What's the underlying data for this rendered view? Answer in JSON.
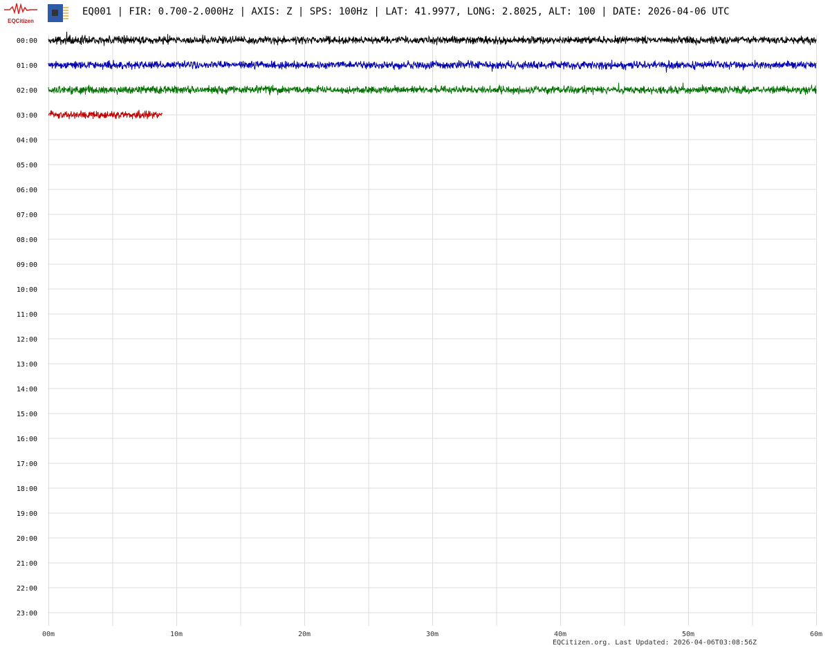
{
  "header": {
    "title": "EQ001 | FIR: 0.700-2.000Hz | AXIS: Z | SPS: 100Hz | LAT: 41.9977, LONG: 2.8025, ALT: 100 | DATE: 2026-04-06 UTC",
    "logo_text": "EQCitizen",
    "logo_icon": "seismogram-logo-icon",
    "device_icon": "sensor-chip-icon"
  },
  "chart_data": {
    "type": "line",
    "title": "EQ001 | FIR: 0.700-2.000Hz | AXIS: Z | SPS: 100Hz | LAT: 41.9977, LONG: 2.8025, ALT: 100 | DATE: 2026-04-06 UTC",
    "xlabel": "",
    "ylabel": "",
    "xlim": [
      0,
      60
    ],
    "x_ticks": [
      "00m",
      "10m",
      "20m",
      "30m",
      "40m",
      "50m",
      "60m"
    ],
    "y_ticks": [
      "00:00",
      "01:00",
      "02:00",
      "03:00",
      "04:00",
      "05:00",
      "06:00",
      "07:00",
      "08:00",
      "09:00",
      "10:00",
      "11:00",
      "12:00",
      "13:00",
      "14:00",
      "15:00",
      "16:00",
      "17:00",
      "18:00",
      "19:00",
      "20:00",
      "21:00",
      "22:00",
      "23:00"
    ],
    "grid": true,
    "series": [
      {
        "name": "00:00",
        "start_min": 0,
        "end_min": 60,
        "color": "#000000"
      },
      {
        "name": "01:00",
        "start_min": 0,
        "end_min": 60,
        "color": "#0000b0"
      },
      {
        "name": "02:00",
        "start_min": 0,
        "end_min": 60,
        "color": "#007000"
      },
      {
        "name": "03:00",
        "start_min": 0,
        "end_min": 8.93,
        "color": "#c00000"
      }
    ]
  },
  "footer": {
    "text": "EQCitizen.org. Last Updated: 2026-04-06T03:08:56Z"
  }
}
